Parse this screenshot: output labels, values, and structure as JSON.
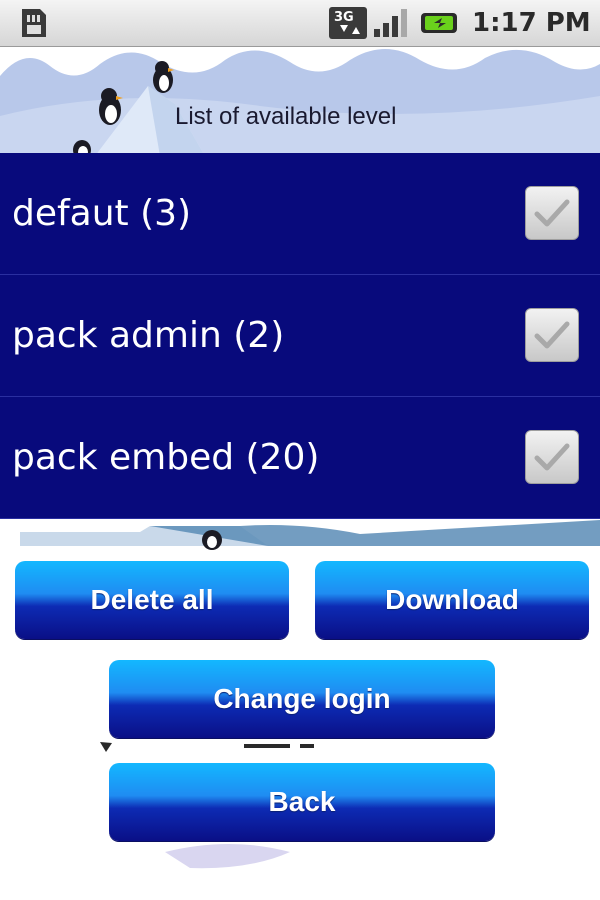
{
  "status_bar": {
    "network": "3G",
    "time": "1:17 PM",
    "icons": [
      "sd-card-icon",
      "3g-icon",
      "signal-icon",
      "battery-icon"
    ]
  },
  "screen": {
    "heading": "List of available level"
  },
  "levels": [
    {
      "label": "defaut (3)",
      "checked": true
    },
    {
      "label": "pack admin (2)",
      "checked": true
    },
    {
      "label": "pack embed (20)",
      "checked": true
    }
  ],
  "buttons": {
    "delete_all": "Delete all",
    "download": "Download",
    "change_login": "Change login",
    "back": "Back"
  },
  "colors": {
    "list_background": "#080a7c",
    "button_top": "#13b8ff",
    "button_bottom": "#0a0f86"
  }
}
